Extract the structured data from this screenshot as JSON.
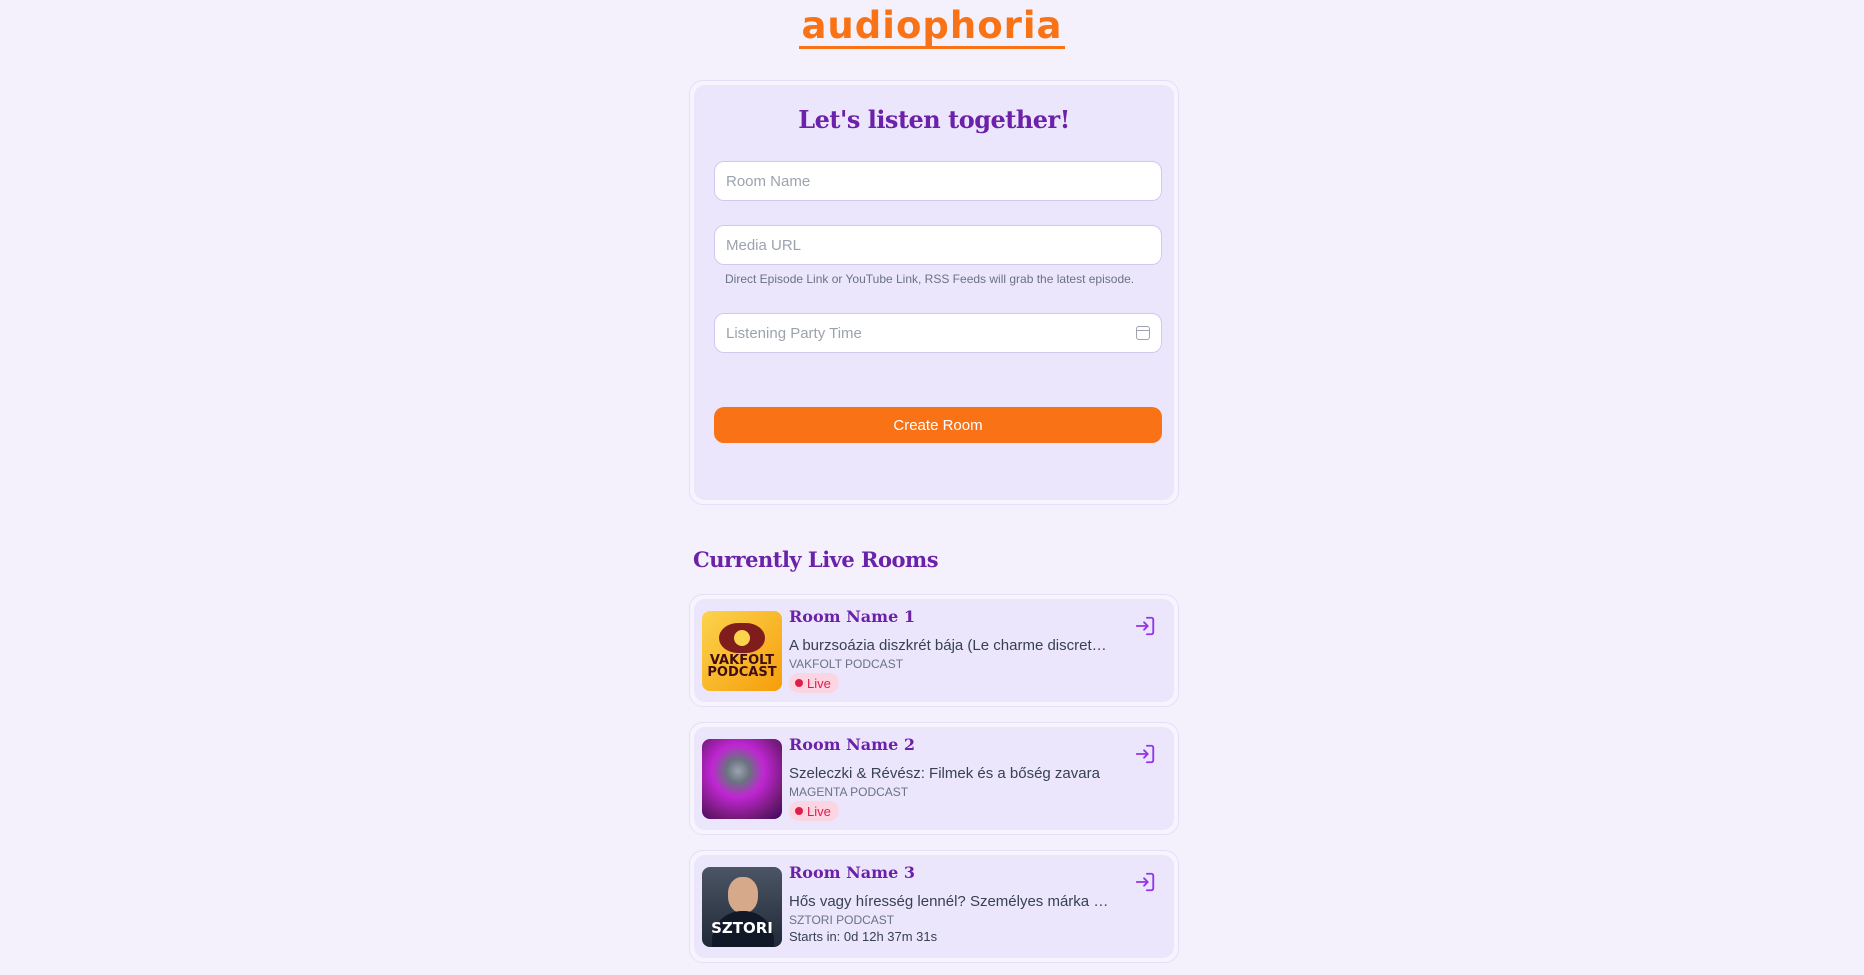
{
  "app": {
    "logo": "audiophoria"
  },
  "create_form": {
    "title": "Let's listen together!",
    "room_name_placeholder": "Room Name",
    "media_url_placeholder": "Media URL",
    "media_url_hint": "Direct Episode Link or YouTube Link, RSS Feeds will grab the latest episode.",
    "party_time_placeholder": "Listening Party Time",
    "create_button": "Create Room"
  },
  "live_rooms": {
    "title": "Currently Live Rooms",
    "rooms": [
      {
        "name": "Room Name 1",
        "episode": "A burzsoázia diszkrét bája (Le charme discret de la bourgeoisie)",
        "podcast": "VAKFOLT PODCAST",
        "thumb_text": "VAKFOLT PODCAST",
        "status": "Live"
      },
      {
        "name": "Room Name 2",
        "episode": "Szeleczki & Révész: Filmek és a bőség zavara",
        "podcast": "MAGENTA PODCAST",
        "status": "Live"
      },
      {
        "name": "Room Name 3",
        "episode": "Hős vagy híresség lennél? Személyes márka építés",
        "podcast": "SZTORI PODCAST",
        "thumb_text": "SZTORI",
        "countdown": "Starts in: 0d 12h 37m 31s"
      }
    ]
  },
  "colors": {
    "accent": "#f97316",
    "brand": "#6b21a8",
    "background": "#f4f1fd"
  },
  "icons": {
    "join": "login-arrow-icon",
    "calendar": "calendar-icon"
  }
}
